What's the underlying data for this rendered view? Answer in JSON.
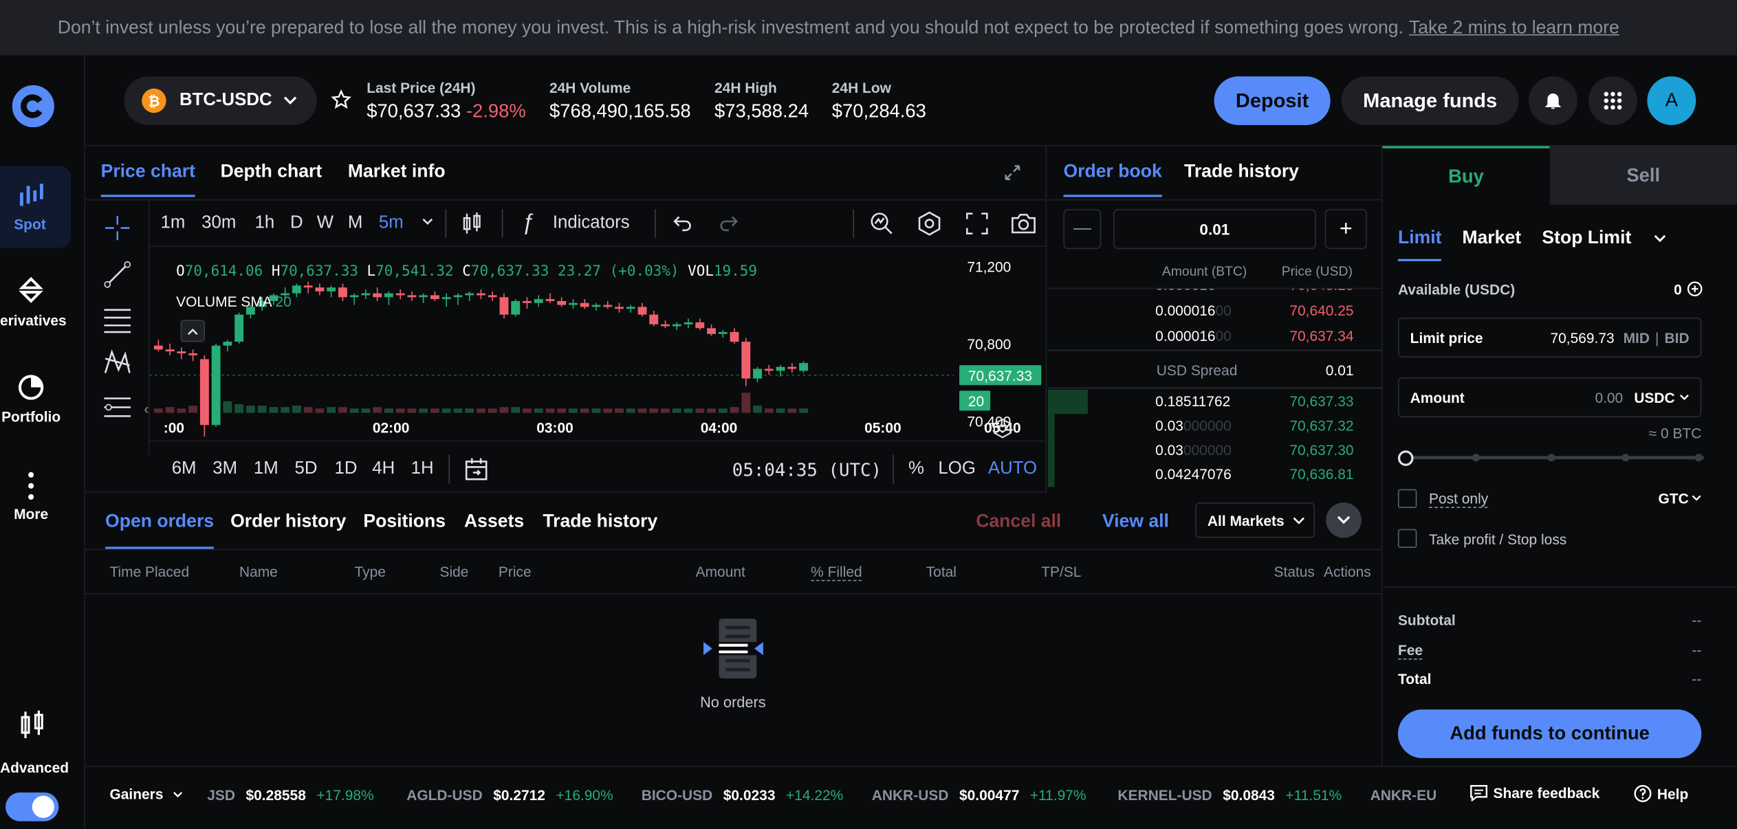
{
  "banner": {
    "text": "Don’t invest unless you’re prepared to lose all the money you invest. This is a high-risk investment and you should not expect to be protected if something goes wrong.",
    "link": "Take 2 mins to learn more"
  },
  "sidebar": {
    "items": [
      {
        "label": "Spot",
        "icon": "spot-icon"
      },
      {
        "label": "erivatives",
        "icon": "derivatives-icon"
      },
      {
        "label": "Portfolio",
        "icon": "portfolio-icon"
      },
      {
        "label": "More",
        "icon": "more-icon"
      },
      {
        "label": "Advanced",
        "icon": "advanced-icon"
      }
    ]
  },
  "header": {
    "pair": "BTC-USDC",
    "last_price_label": "Last Price (24H)",
    "last_price": "$70,637.33",
    "change": "-2.98%",
    "volume_label": "24H Volume",
    "volume": "$768,490,165.58",
    "high_label": "24H High",
    "high": "$73,588.24",
    "low_label": "24H Low",
    "low": "$70,284.63",
    "deposit": "Deposit",
    "manage_funds": "Manage funds",
    "avatar": "A"
  },
  "chart_tabs": [
    "Price chart",
    "Depth chart",
    "Market info"
  ],
  "chart_toolbar": {
    "intervals": [
      "1m",
      "30m",
      "1h",
      "D",
      "W",
      "M",
      "5m"
    ],
    "indicators": "Indicators"
  },
  "chart_legend": {
    "o_label": "O",
    "o": "70,614.06",
    "h_label": "H",
    "h": "70,637.33",
    "l_label": "L",
    "l": "70,541.32",
    "c_label": "C",
    "c": "70,637.33",
    "change": "23.27 (+0.03%)",
    "vol_label": "VOL",
    "vol": "19.59",
    "volume_sma_label": "VOLUME SMA",
    "volume_sma": "20"
  },
  "chart_data": {
    "type": "candlestick",
    "x_ticks": [
      ":00",
      "02:00",
      "03:00",
      "04:00",
      "05:00",
      "05:40"
    ],
    "y_ticks": [
      "71,200",
      "70,800",
      "70,400"
    ],
    "ylim": [
      70300,
      71300
    ],
    "current_price": "70,637.33",
    "volume_badge": "20",
    "candles": [
      [
        70790,
        70820,
        70760,
        70770
      ],
      [
        70770,
        70800,
        70740,
        70760
      ],
      [
        70760,
        70780,
        70720,
        70750
      ],
      [
        70750,
        70770,
        70710,
        70740
      ],
      [
        70720,
        70740,
        70320,
        70380
      ],
      [
        70380,
        70800,
        70370,
        70790
      ],
      [
        70790,
        70820,
        70760,
        70810
      ],
      [
        70810,
        70960,
        70800,
        70950
      ],
      [
        70950,
        71000,
        70930,
        70990
      ],
      [
        70990,
        71040,
        70970,
        71020
      ],
      [
        71020,
        71060,
        71000,
        71050
      ],
      [
        71050,
        71090,
        71030,
        71060
      ],
      [
        71060,
        71110,
        71040,
        71100
      ],
      [
        71100,
        71120,
        71060,
        71090
      ],
      [
        71090,
        71110,
        71050,
        71070
      ],
      [
        71070,
        71100,
        71040,
        71090
      ],
      [
        71090,
        71110,
        71020,
        71040
      ],
      [
        71040,
        71060,
        71000,
        71050
      ],
      [
        71050,
        71080,
        71030,
        71060
      ],
      [
        71060,
        71090,
        71020,
        71040
      ],
      [
        71040,
        71070,
        71000,
        71060
      ],
      [
        71060,
        71080,
        71030,
        71050
      ],
      [
        71050,
        71070,
        71020,
        71040
      ],
      [
        71040,
        71060,
        71010,
        71050
      ],
      [
        71050,
        71070,
        71020,
        71030
      ],
      [
        71030,
        71060,
        70990,
        71040
      ],
      [
        71040,
        71060,
        71000,
        71050
      ],
      [
        71050,
        71070,
        71020,
        71060
      ],
      [
        71060,
        71080,
        71030,
        71050
      ],
      [
        71050,
        71070,
        71020,
        71040
      ],
      [
        71040,
        71060,
        70930,
        70950
      ],
      [
        70950,
        71030,
        70940,
        71020
      ],
      [
        71020,
        71040,
        70980,
        71010
      ],
      [
        71010,
        71050,
        70990,
        71030
      ],
      [
        71030,
        71060,
        71010,
        71020
      ],
      [
        71020,
        71040,
        70990,
        71000
      ],
      [
        71000,
        71030,
        70980,
        71010
      ],
      [
        71010,
        71030,
        70980,
        70990
      ],
      [
        70990,
        71010,
        70970,
        71000
      ],
      [
        71000,
        71020,
        70980,
        70990
      ],
      [
        70990,
        71010,
        70960,
        70980
      ],
      [
        70980,
        71000,
        70960,
        70990
      ],
      [
        70990,
        71010,
        70940,
        70950
      ],
      [
        70950,
        70970,
        70890,
        70900
      ],
      [
        70900,
        70920,
        70880,
        70890
      ],
      [
        70890,
        70910,
        70870,
        70900
      ],
      [
        70900,
        70930,
        70880,
        70910
      ],
      [
        70910,
        70930,
        70870,
        70880
      ],
      [
        70880,
        70900,
        70840,
        70850
      ],
      [
        70850,
        70870,
        70830,
        70860
      ],
      [
        70860,
        70880,
        70800,
        70810
      ],
      [
        70810,
        70830,
        70580,
        70620
      ],
      [
        70620,
        70680,
        70600,
        70670
      ],
      [
        70670,
        70690,
        70640,
        70660
      ],
      [
        70660,
        70690,
        70630,
        70680
      ],
      [
        70680,
        70700,
        70650,
        70670
      ],
      [
        70660,
        70710,
        70650,
        70700
      ]
    ],
    "volumes": [
      3,
      4,
      3,
      5,
      10,
      12,
      8,
      6,
      5,
      5,
      4,
      4,
      5,
      4,
      3,
      4,
      4,
      3,
      3,
      4,
      3,
      3,
      3,
      3,
      3,
      3,
      3,
      3,
      3,
      3,
      4,
      4,
      3,
      3,
      3,
      3,
      3,
      3,
      3,
      3,
      3,
      3,
      3,
      3,
      3,
      3,
      3,
      3,
      3,
      3,
      4,
      14,
      5,
      3,
      3,
      3,
      3
    ]
  },
  "chart_bottom": {
    "ranges": [
      "6M",
      "3M",
      "1M",
      "5D",
      "1D",
      "4H",
      "1H"
    ],
    "time": "05:04:35 (UTC)",
    "percent": "%",
    "log": "LOG",
    "auto": "AUTO"
  },
  "orderbook": {
    "tabs": [
      "Order book",
      "Trade history"
    ],
    "step": "0.01",
    "minus": "—",
    "plus": "+",
    "amount_header": "Amount (BTC)",
    "price_header": "Price (USD)",
    "asks": [
      {
        "amount": "0.000016",
        "fade": "00",
        "price": "70,640.25"
      },
      {
        "amount": "0.000016",
        "fade": "00",
        "price": "70,637.34"
      }
    ],
    "spread_label": "USD Spread",
    "spread": "0.01",
    "bids": [
      {
        "amount": "0.18511762",
        "fade": "",
        "price": "70,637.33",
        "depth": 0.12
      },
      {
        "amount": "0.03",
        "fade": "000000",
        "price": "70,637.32",
        "depth": 0.02
      },
      {
        "amount": "0.03",
        "fade": "000000",
        "price": "70,637.30",
        "depth": 0.02
      },
      {
        "amount": "0.04247076",
        "fade": "",
        "price": "70,636.81",
        "depth": 0.02
      }
    ]
  },
  "orders": {
    "tabs": [
      "Open orders",
      "Order history",
      "Positions",
      "Assets",
      "Trade history"
    ],
    "cancel_all": "Cancel all",
    "view_all": "View all",
    "market_filter": "All Markets",
    "columns": [
      "Time Placed",
      "Name",
      "Type",
      "Side",
      "Price",
      "Amount",
      "% Filled",
      "Total",
      "TP/SL",
      "Status",
      "Actions"
    ],
    "empty": "No orders"
  },
  "trade": {
    "buy": "Buy",
    "sell": "Sell",
    "types": [
      "Limit",
      "Market",
      "Stop Limit"
    ],
    "available_label": "Available (USDC)",
    "available": "0",
    "limit_price_label": "Limit price",
    "limit_price": "70,569.73",
    "mid": "MID",
    "bid": "BID",
    "amount_label": "Amount",
    "amount_placeholder": "0.00",
    "currency": "USDC",
    "approx": "≈ 0 BTC",
    "slider_fraction": 0,
    "post_only": "Post only",
    "gtc": "GTC",
    "tpsl": "Take profit / Stop loss",
    "subtotal_label": "Subtotal",
    "subtotal": "--",
    "fee_label": "Fee",
    "fee": "--",
    "total_label": "Total",
    "total": "--",
    "cta": "Add funds to continue"
  },
  "ticker": {
    "gainers": "Gainers",
    "items": [
      {
        "symbol": "JSD",
        "price": "$0.28558",
        "change": "+17.98%"
      },
      {
        "symbol": "AGLD-USD",
        "price": "$0.2712",
        "change": "+16.90%"
      },
      {
        "symbol": "BICO-USD",
        "price": "$0.0233",
        "change": "+14.22%"
      },
      {
        "symbol": "ANKR-USD",
        "price": "$0.00477",
        "change": "+11.97%"
      },
      {
        "symbol": "KERNEL-USD",
        "price": "$0.0843",
        "change": "+11.51%"
      },
      {
        "symbol": "ANKR-EUR",
        "price": "",
        "change": ""
      }
    ],
    "feedback": "Share feedback",
    "help": "Help"
  }
}
